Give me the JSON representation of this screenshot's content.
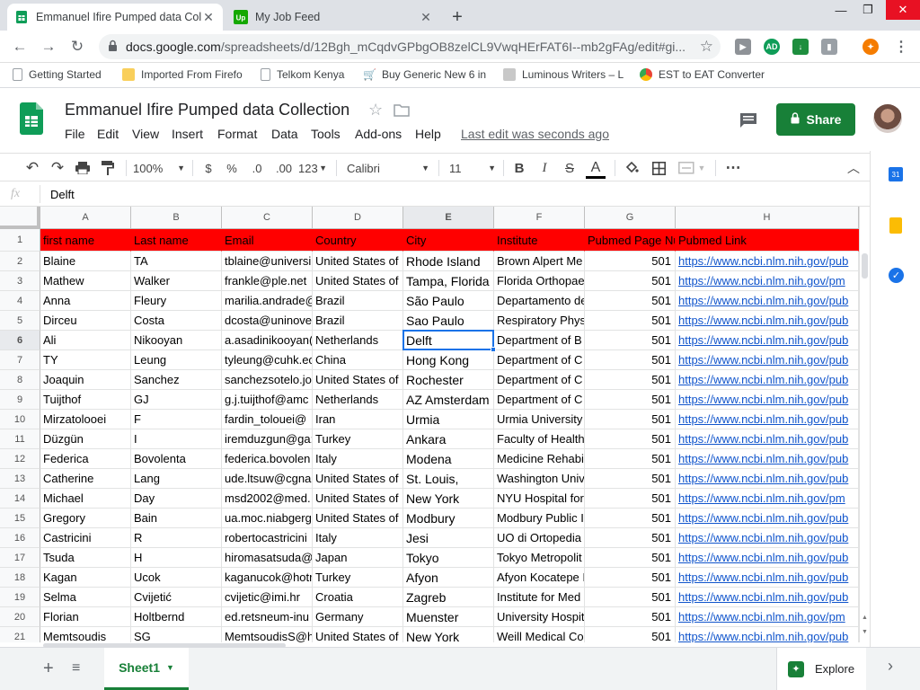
{
  "browser": {
    "tabs": [
      {
        "title": "Emmanuel Ifire Pumped data Col",
        "active": true
      },
      {
        "title": "My Job Feed",
        "active": false
      }
    ],
    "new_tab": "+",
    "url_domain": "docs.google.com",
    "url_path": "/spreadsheets/d/12Bgh_mCqdvGPbgOB8zelCL9VwqHErFAT6I--mb2gFAg/edit#gi...",
    "bookmarks": [
      "Getting Started",
      "Imported From Firefo",
      "Telkom Kenya",
      "Buy Generic New 6 in",
      "Luminous Writers – L",
      "EST to EAT Converter"
    ],
    "ext_badge": "AD"
  },
  "doc": {
    "title": "Emmanuel Ifire Pumped data Collection",
    "menu": [
      "File",
      "Edit",
      "View",
      "Insert",
      "Format",
      "Data",
      "Tools",
      "Add-ons",
      "Help"
    ],
    "last_edit": "Last edit was seconds ago",
    "share_label": "Share"
  },
  "toolbar": {
    "zoom": "100%",
    "currency": "$",
    "percent": "%",
    "dec_less": ".0",
    "dec_more": ".00",
    "more_formats": "123",
    "font": "Calibri",
    "font_size": "11",
    "bold": "B",
    "italic": "I",
    "strike": "S",
    "text_color": "A",
    "more": "⋯"
  },
  "formula_bar": {
    "fx": "fx",
    "value": "Delft"
  },
  "grid": {
    "columns": [
      "A",
      "B",
      "C",
      "D",
      "E",
      "F",
      "G",
      "H"
    ],
    "selected_cell": "E6",
    "header_row": [
      "first name",
      "Last name",
      "Email",
      "Country",
      "City",
      "Institute",
      "Pubmed Page Nu",
      "Pubmed Link"
    ],
    "rows": [
      {
        "n": "2",
        "cells": [
          "Blaine",
          "TA",
          "tblaine@universi",
          "United States of",
          "Rhode Island",
          "Brown Alpert Me",
          "501",
          "https://www.ncbi.nlm.nih.gov/pub"
        ]
      },
      {
        "n": "3",
        "cells": [
          "Mathew",
          "Walker",
          "frankle@ple.net",
          "United States of",
          "Tampa, Florida 3",
          "Florida Orthopae",
          "501",
          "https://www.ncbi.nlm.nih.gov/pm"
        ]
      },
      {
        "n": "4",
        "cells": [
          "Anna",
          "Fleury",
          "marilia.andrade@",
          "Brazil",
          "São Paulo",
          "Departamento de",
          "501",
          "https://www.ncbi.nlm.nih.gov/pub"
        ]
      },
      {
        "n": "5",
        "cells": [
          "Dirceu",
          "Costa",
          "dcosta@uninove",
          "Brazil",
          "Sao Paulo",
          "Respiratory Phys",
          "501",
          "https://www.ncbi.nlm.nih.gov/pub"
        ]
      },
      {
        "n": "6",
        "cells": [
          "Ali",
          "Nikooyan",
          "a.asadinikooyan(",
          "Netherlands",
          "Delft",
          "Department of B",
          "501",
          "https://www.ncbi.nlm.nih.gov/pub"
        ]
      },
      {
        "n": "7",
        "cells": [
          "TY",
          "Leung",
          "tyleung@cuhk.ec",
          "China",
          "Hong Kong",
          "Department of C",
          "501",
          "https://www.ncbi.nlm.nih.gov/pub"
        ]
      },
      {
        "n": "8",
        "cells": [
          "Joaquin",
          "Sanchez",
          "sanchezsotelo.jo",
          "United States of",
          "Rochester",
          "Department of C",
          "501",
          "https://www.ncbi.nlm.nih.gov/pub"
        ]
      },
      {
        "n": "9",
        "cells": [
          "Tuijthof",
          "GJ",
          "g.j.tuijthof@amc",
          "Netherlands",
          "AZ Amsterdam",
          "Department of C",
          "501",
          "https://www.ncbi.nlm.nih.gov/pub"
        ]
      },
      {
        "n": "10",
        "cells": [
          "Mirzatolooei",
          "F",
          "fardin_tolouei@",
          "Iran",
          "Urmia",
          "Urmia University",
          "501",
          "https://www.ncbi.nlm.nih.gov/pub"
        ]
      },
      {
        "n": "11",
        "cells": [
          "Düzgün",
          "I",
          "iremduzgun@ga:",
          "Turkey",
          "Ankara",
          "Faculty of Health",
          "501",
          "https://www.ncbi.nlm.nih.gov/pub"
        ]
      },
      {
        "n": "12",
        "cells": [
          "Federica",
          "Bovolenta",
          "federica.bovolen",
          "Italy",
          "Modena",
          "Medicine Rehabi",
          "501",
          "https://www.ncbi.nlm.nih.gov/pub"
        ]
      },
      {
        "n": "13",
        "cells": [
          "Catherine",
          "Lang",
          "ude.ltsuw@cgna",
          "United States of",
          "St. Louis,",
          "Washington Univ",
          "501",
          "https://www.ncbi.nlm.nih.gov/pub"
        ]
      },
      {
        "n": "14",
        "cells": [
          "Michael",
          "Day",
          "msd2002@med.",
          "United States of",
          "New York",
          "NYU Hospital for",
          "501",
          "https://www.ncbi.nlm.nih.gov/pm"
        ]
      },
      {
        "n": "15",
        "cells": [
          "Gregory",
          "Bain",
          "ua.moc.niabgerg",
          "United States of",
          "Modbury",
          "Modbury Public I",
          "501",
          "https://www.ncbi.nlm.nih.gov/pub"
        ]
      },
      {
        "n": "16",
        "cells": [
          "Castricini",
          "R",
          "robertocastricini",
          "Italy",
          "Jesi",
          "UO di Ortopedia",
          "501",
          "https://www.ncbi.nlm.nih.gov/pub"
        ]
      },
      {
        "n": "17",
        "cells": [
          "Tsuda",
          "H",
          "hiromasatsuda@",
          "Japan",
          "Tokyo",
          "Tokyo Metropolit",
          "501",
          "https://www.ncbi.nlm.nih.gov/pub"
        ]
      },
      {
        "n": "18",
        "cells": [
          "Kagan",
          "Ucok",
          "kaganucok@hotr",
          "Turkey",
          "Afyon",
          "Afyon Kocatepe I",
          "501",
          "https://www.ncbi.nlm.nih.gov/pub"
        ]
      },
      {
        "n": "19",
        "cells": [
          "Selma",
          "Cvijetić",
          "cvijetic@imi.hr",
          "Croatia",
          "Zagreb",
          "Institute for Med",
          "501",
          "https://www.ncbi.nlm.nih.gov/pub"
        ]
      },
      {
        "n": "20",
        "cells": [
          "Florian",
          "Holtbernd",
          "ed.retsneum-inu",
          "Germany",
          "Muenster",
          "University Hospit",
          "501",
          "https://www.ncbi.nlm.nih.gov/pm"
        ]
      },
      {
        "n": "21",
        "cells": [
          "Memtsoudis",
          "SG",
          "MemtsoudisS@h",
          "United States of",
          "New York",
          "Weill Medical Co",
          "501",
          "https://www.ncbi.nlm.nih.gov/pub"
        ]
      }
    ]
  },
  "sheets": {
    "active": "Sheet1",
    "explore_label": "Explore"
  },
  "colors": {
    "share_green": "#188038",
    "header_red": "#ff0000",
    "selection_blue": "#1a73e8",
    "link_blue": "#1155cc"
  }
}
